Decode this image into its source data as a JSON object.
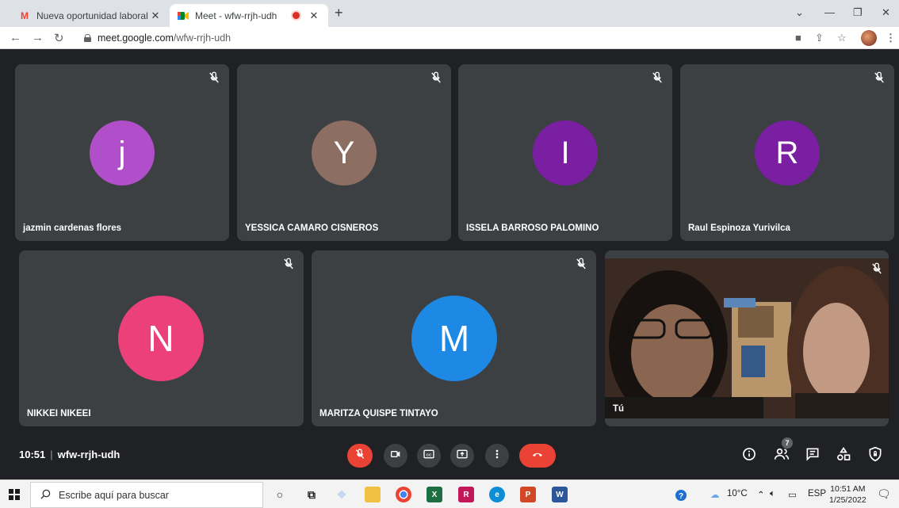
{
  "browser": {
    "tabs": [
      {
        "title": "Nueva oportunidad laboral en Ve",
        "favicon": "gmail-icon"
      },
      {
        "title": "Meet - wfw-rrjh-udh",
        "favicon": "meet-icon",
        "recording": true
      }
    ],
    "url_host": "meet.google.com",
    "url_path": "/wfw-rrjh-udh"
  },
  "participants": [
    {
      "name": "jazmin cardenas flores",
      "initial": "j",
      "color": "#b04fc9",
      "muted": true
    },
    {
      "name": "YESSICA CAMARO CISNEROS",
      "initial": "Y",
      "color": "#8d6e63",
      "muted": true
    },
    {
      "name": "ISSELA BARROSO PALOMINO",
      "initial": "I",
      "color": "#7b1fa2",
      "muted": true
    },
    {
      "name": "Raul Espinoza Yurivilca",
      "initial": "R",
      "color": "#7b1fa2",
      "muted": true
    },
    {
      "name": "NIKKEI NIKEEI",
      "initial": "N",
      "color": "#ec407a",
      "muted": true
    },
    {
      "name": "MARITZA QUISPE TINTAYO",
      "initial": "M",
      "color": "#1e88e5",
      "muted": true
    },
    {
      "name": "Tú",
      "self": true,
      "muted": true
    }
  ],
  "meeting": {
    "time": "10:51",
    "code": "wfw-rrjh-udh",
    "people_count": "7"
  },
  "controls": [
    "mic-off-icon",
    "camera-icon",
    "captions-icon",
    "present-icon",
    "more-icon",
    "hangup-icon"
  ],
  "right_controls": [
    "info-icon",
    "people-icon",
    "chat-icon",
    "activities-icon",
    "host-controls-icon"
  ],
  "taskbar": {
    "search_placeholder": "Escribe aquí para buscar",
    "weather": "10°C",
    "lang": "ESP",
    "time": "10:51 AM",
    "date": "1/25/2022",
    "notifications": "1"
  }
}
